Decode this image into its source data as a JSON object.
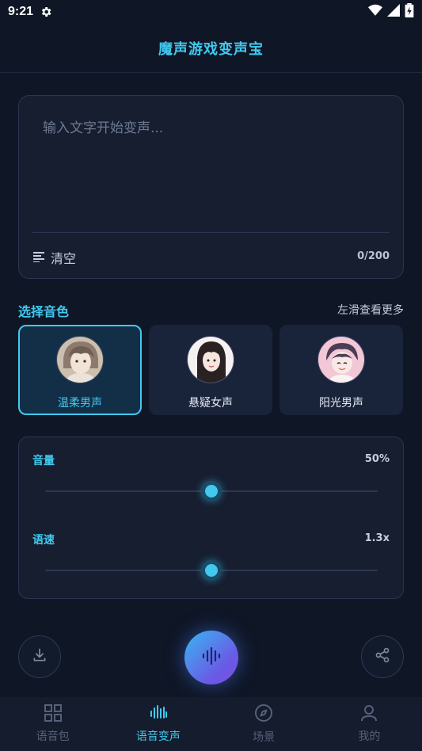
{
  "status_bar": {
    "time": "9:21"
  },
  "header": {
    "title": "魔声游戏变声宝"
  },
  "text_card": {
    "placeholder": "输入文字开始变声...",
    "value": "",
    "clear_label": "清空",
    "char_count": "0/200"
  },
  "voice_section": {
    "title": "选择音色",
    "hint": "左滑查看更多",
    "voices": [
      {
        "name": "温柔男声",
        "selected": true
      },
      {
        "name": "悬疑女声",
        "selected": false
      },
      {
        "name": "阳光男声",
        "selected": false
      }
    ]
  },
  "sliders": {
    "volume": {
      "label": "音量",
      "value": "50%",
      "fraction": 0.5
    },
    "speed": {
      "label": "语速",
      "value": "1.3x",
      "fraction": 0.5
    }
  },
  "bottom_nav": {
    "items": [
      {
        "label": "语音包",
        "icon": "grid-icon",
        "active": false
      },
      {
        "label": "语音变声",
        "icon": "waveform-icon",
        "active": true
      },
      {
        "label": "场景",
        "icon": "compass-icon",
        "active": false
      },
      {
        "label": "我的",
        "icon": "user-icon",
        "active": false
      }
    ]
  },
  "colors": {
    "accent": "#41c9ee",
    "background": "#0f1626",
    "card": "#161e30"
  }
}
